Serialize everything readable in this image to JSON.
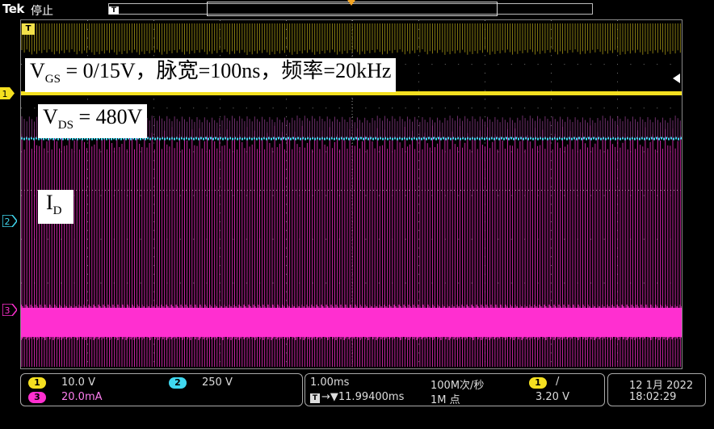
{
  "header": {
    "brand": "Tek",
    "status": "停止",
    "trigger_marker": "T"
  },
  "annotations": {
    "vgs": {
      "main": "V",
      "sub": "GS",
      "rest": " = 0/15V，脉宽=100ns，频率=20kHz"
    },
    "vds": {
      "main": "V",
      "sub": "DS",
      "rest": " = 480V"
    },
    "id": {
      "main": "I",
      "sub": "D",
      "rest": ""
    }
  },
  "channels": {
    "ch1": {
      "label": "1",
      "color": "#f5e020",
      "scale": "10.0 V"
    },
    "ch2": {
      "label": "2",
      "color": "#40d8f0",
      "scale": "250 V"
    },
    "ch3": {
      "label": "3",
      "color": "#ff2fd0",
      "scale": "20.0mA"
    }
  },
  "horizontal": {
    "timebase": "1.00ms",
    "position": "→▼11.99400ms",
    "sample_rate": "100M次/秒",
    "record_length": "1M 点"
  },
  "trigger": {
    "source": "1",
    "slope_icon": "/",
    "level": "3.20 V"
  },
  "datetime": {
    "date": "12 1月 2022",
    "time": "18:02:29"
  }
}
